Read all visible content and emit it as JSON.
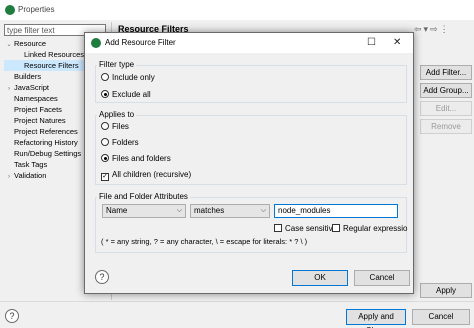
{
  "outer": {
    "title": "Properties",
    "filter_placeholder": "type filter text",
    "tree": [
      {
        "label": "Resource",
        "arrow": "v",
        "indent": 0
      },
      {
        "label": "Linked Resources",
        "arrow": "",
        "indent": 1
      },
      {
        "label": "Resource Filters",
        "arrow": "",
        "indent": 1
      },
      {
        "label": "Builders",
        "arrow": "",
        "indent": 0
      },
      {
        "label": "JavaScript",
        "arrow": ">",
        "indent": 0
      },
      {
        "label": "Namespaces",
        "arrow": "",
        "indent": 0
      },
      {
        "label": "Project Facets",
        "arrow": "",
        "indent": 0
      },
      {
        "label": "Project Natures",
        "arrow": "",
        "indent": 0
      },
      {
        "label": "Project References",
        "arrow": "",
        "indent": 0
      },
      {
        "label": "Refactoring History",
        "arrow": "",
        "indent": 0
      },
      {
        "label": "Run/Debug Settings",
        "arrow": "",
        "indent": 0
      },
      {
        "label": "Task Tags",
        "arrow": "",
        "indent": 0
      },
      {
        "label": "Validation",
        "arrow": ">",
        "indent": 0
      }
    ],
    "page_header": "Resource Filters",
    "side_buttons": {
      "add_filter": "Add Filter...",
      "add_group": "Add Group...",
      "edit": "Edit...",
      "remove": "Remove"
    },
    "apply": "Apply",
    "apply_and_close": "Apply and Close",
    "cancel": "Cancel",
    "help": "?"
  },
  "dialog": {
    "title": "Add Resource Filter",
    "filter_type": {
      "label": "Filter type",
      "include_only": "Include only",
      "exclude_all": "Exclude all"
    },
    "applies_to": {
      "label": "Applies to",
      "files": "Files",
      "folders": "Folders",
      "files_and_folders": "Files and folders",
      "all_children": "All children (recursive)"
    },
    "attributes": {
      "label": "File and Folder Attributes",
      "attribute": "Name",
      "operator": "matches",
      "value": "node_modules",
      "case_sensitive": "Case sensitive",
      "regular_expression": "Regular expressio",
      "hint": "( * = any string, ? = any character, \\ = escape for literals: * ? \\ )"
    },
    "ok": "OK",
    "cancel": "Cancel",
    "help": "?"
  }
}
